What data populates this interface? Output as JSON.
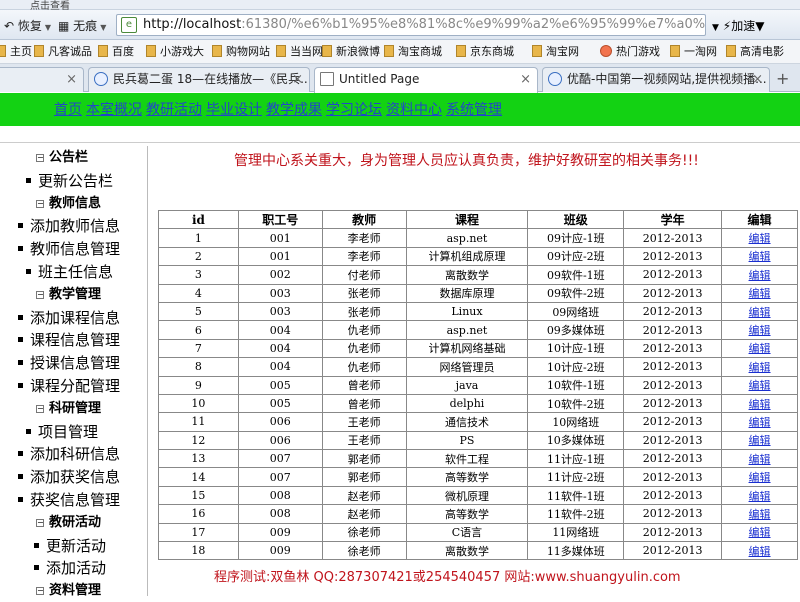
{
  "browser": {
    "top_strip_text": "点击查看",
    "nav": {
      "restore_label": "恢复",
      "trace_label": "无痕",
      "speed_label": "加速"
    },
    "url": {
      "host": "http://localhost",
      "rest": ":61380/%e6%b1%95%e8%81%8c%e9%99%a2%e6%95%99%e7%a0%94%e5%ae9"
    },
    "bookmarks": [
      "主页",
      "凡客诚品",
      "百度",
      "小游戏大",
      "购物网站",
      "当当网",
      "新浪微博",
      "淘宝商城",
      "京东商城",
      "淘宝网",
      "热门游戏",
      "一淘网",
      "高清电影"
    ],
    "tabs": [
      {
        "label": "民兵葛二蛋 18—在线播放—《民兵..."
      },
      {
        "label": "Untitled Page"
      },
      {
        "label": "优酷-中国第一视频网站,提供视频播..."
      }
    ]
  },
  "menu": [
    "首页",
    "本室概况",
    "教研活动",
    "毕业设计",
    "教学成果",
    "学习论坛",
    "资料中心",
    "系统管理"
  ],
  "sidebar": [
    {
      "type": "group",
      "label": "公告栏"
    },
    {
      "type": "item",
      "label": "更新公告栏"
    },
    {
      "type": "group",
      "label": "教师信息"
    },
    {
      "type": "item",
      "label": "添加教师信息"
    },
    {
      "type": "item",
      "label": "教师信息管理"
    },
    {
      "type": "item",
      "label": "班主任信息"
    },
    {
      "type": "group",
      "label": "教学管理"
    },
    {
      "type": "item",
      "label": "添加课程信息"
    },
    {
      "type": "item",
      "label": "课程信息管理"
    },
    {
      "type": "item",
      "label": "授课信息管理"
    },
    {
      "type": "item",
      "label": "课程分配管理"
    },
    {
      "type": "group",
      "label": "科研管理"
    },
    {
      "type": "item",
      "label": "项目管理"
    },
    {
      "type": "item",
      "label": "添加科研信息"
    },
    {
      "type": "item",
      "label": "添加获奖信息"
    },
    {
      "type": "item",
      "label": "获奖信息管理"
    },
    {
      "type": "group",
      "label": "教研活动"
    },
    {
      "type": "item",
      "label": "更新活动"
    },
    {
      "type": "item",
      "label": "添加活动"
    },
    {
      "type": "group",
      "label": "资料管理"
    }
  ],
  "notice": "管理中心系关重大，身为管理人员应认真负责，维护好教研室的相关事务!!!",
  "table": {
    "headers": [
      "id",
      "职工号",
      "教师",
      "课程",
      "班级",
      "学年",
      "编辑"
    ],
    "rows": [
      [
        "1",
        "001",
        "李老师",
        "asp.net",
        "09计应-1班",
        "2012-2013",
        "编辑"
      ],
      [
        "2",
        "001",
        "李老师",
        "计算机组成原理",
        "09计应-2班",
        "2012-2013",
        "编辑"
      ],
      [
        "3",
        "002",
        "付老师",
        "离散数学",
        "09软件-1班",
        "2012-2013",
        "编辑"
      ],
      [
        "4",
        "003",
        "张老师",
        "数据库原理",
        "09软件-2班",
        "2012-2013",
        "编辑"
      ],
      [
        "5",
        "003",
        "张老师",
        "Linux",
        "09网络班",
        "2012-2013",
        "编辑"
      ],
      [
        "6",
        "004",
        "仇老师",
        "asp.net",
        "09多媒体班",
        "2012-2013",
        "编辑"
      ],
      [
        "7",
        "004",
        "仇老师",
        "计算机网络基础",
        "10计应-1班",
        "2012-2013",
        "编辑"
      ],
      [
        "8",
        "004",
        "仇老师",
        "网络管理员",
        "10计应-2班",
        "2012-2013",
        "编辑"
      ],
      [
        "9",
        "005",
        "曾老师",
        "java",
        "10软件-1班",
        "2012-2013",
        "编辑"
      ],
      [
        "10",
        "005",
        "曾老师",
        "delphi",
        "10软件-2班",
        "2012-2013",
        "编辑"
      ],
      [
        "11",
        "006",
        "王老师",
        "通信技术",
        "10网络班",
        "2012-2013",
        "编辑"
      ],
      [
        "12",
        "006",
        "王老师",
        "PS",
        "10多媒体班",
        "2012-2013",
        "编辑"
      ],
      [
        "13",
        "007",
        "郭老师",
        "软件工程",
        "11计应-1班",
        "2012-2013",
        "编辑"
      ],
      [
        "14",
        "007",
        "郭老师",
        "高等数学",
        "11计应-2班",
        "2012-2013",
        "编辑"
      ],
      [
        "15",
        "008",
        "赵老师",
        "微机原理",
        "11软件-1班",
        "2012-2013",
        "编辑"
      ],
      [
        "16",
        "008",
        "赵老师",
        "高等数学",
        "11软件-2班",
        "2012-2013",
        "编辑"
      ],
      [
        "17",
        "009",
        "徐老师",
        "C语言",
        "11网络班",
        "2012-2013",
        "编辑"
      ],
      [
        "18",
        "009",
        "徐老师",
        "离散数学",
        "11多媒体班",
        "2012-2013",
        "编辑"
      ]
    ]
  },
  "footer": "程序测试:双鱼林 QQ:287307421或254540457 网站:www.shuangyulin.com",
  "colors": {
    "menu_bar": "#13d213",
    "notice_text": "#c0141c",
    "link": "#1a2fd0"
  }
}
